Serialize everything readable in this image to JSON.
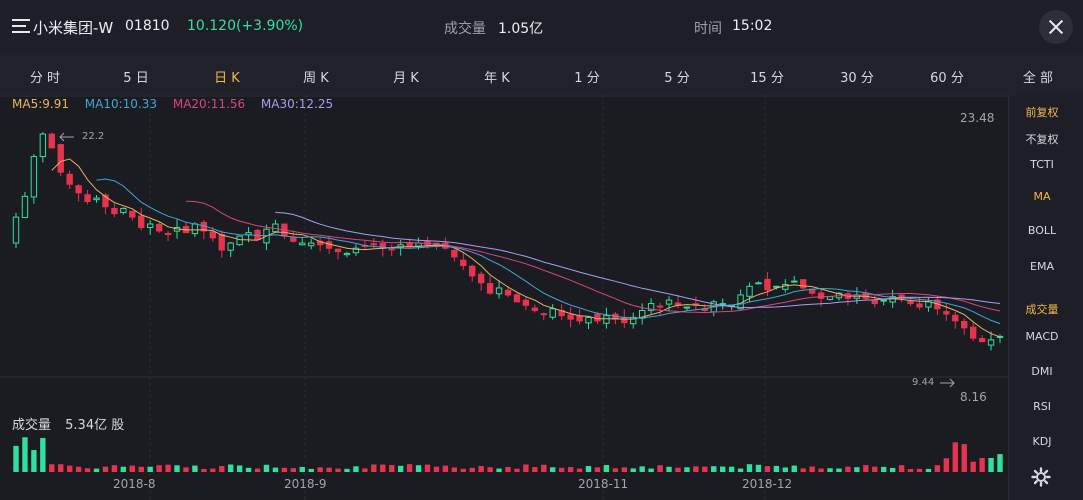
{
  "header": {
    "stock_name": "小米集团-W",
    "stock_code": "01810",
    "price_change": "10.120(+3.90%)",
    "volume_label": "成交量",
    "volume_value": "1.05亿",
    "time_label": "时间",
    "time_value": "15:02"
  },
  "tabs": [
    {
      "label": "分 时"
    },
    {
      "label": "5 日"
    },
    {
      "label": "日 K",
      "active": true
    },
    {
      "label": "周 K"
    },
    {
      "label": "月 K"
    },
    {
      "label": "年 K"
    },
    {
      "label": "1 分"
    },
    {
      "label": "5 分"
    },
    {
      "label": "15 分"
    },
    {
      "label": "30 分"
    },
    {
      "label": "60 分"
    },
    {
      "label": "全 部"
    }
  ],
  "ma_legend": [
    {
      "text": "MA5:9.91",
      "color": "#e6b462"
    },
    {
      "text": "MA10:10.33",
      "color": "#3fa6d8"
    },
    {
      "text": "MA20:11.56",
      "color": "#d9467a"
    },
    {
      "text": "MA30:12.25",
      "color": "#a89cf0"
    }
  ],
  "price_axis": {
    "high_label": "23.48",
    "low_label": "8.16",
    "max_marker": "22.2",
    "min_marker": "9.44"
  },
  "volume_panel": {
    "label": "成交量",
    "value": "5.34亿 股"
  },
  "date_labels": [
    "2018-8",
    "2018-9",
    "2018-11",
    "2018-12"
  ],
  "sidebar": {
    "items": [
      {
        "label": "前复权",
        "active": true
      },
      {
        "label": "不复权"
      },
      {
        "label": "TCTI"
      },
      {
        "label": "MA",
        "active": true
      },
      {
        "label": "BOLL"
      },
      {
        "label": "EMA"
      },
      {
        "label": "成交量",
        "active": true
      },
      {
        "label": "MACD"
      },
      {
        "label": "DMI"
      },
      {
        "label": "RSI"
      },
      {
        "label": "KDJ"
      }
    ]
  },
  "colors": {
    "up": "#2fe0a0",
    "down": "#e8334f",
    "accent": "#f2b84b",
    "ma5": "#e6b462",
    "ma10": "#3fa6d8",
    "ma20": "#d9467a",
    "ma30": "#a89cf0"
  },
  "icons": {
    "menu": "menu-icon",
    "close": "close-icon",
    "settings": "gear-icon"
  },
  "chart_data": {
    "type": "candlestick",
    "x_range": [
      "2018-07",
      "2018-12"
    ],
    "y_range": [
      8.16,
      23.48
    ],
    "closes": [
      17.0,
      18.2,
      20.5,
      21.8,
      21.0,
      19.6,
      18.9,
      18.4,
      17.9,
      18.1,
      17.6,
      17.2,
      17.5,
      17.0,
      16.4,
      16.6,
      16.2,
      16.0,
      16.4,
      16.1,
      16.6,
      16.2,
      15.8,
      15.1,
      15.5,
      15.9,
      16.1,
      15.7,
      16.3,
      16.6,
      15.9,
      15.6,
      15.5,
      15.5,
      15.4,
      15.2,
      15.0,
      14.9,
      15.2,
      15.3,
      15.4,
      15.2,
      15.1,
      15.4,
      15.3,
      15.5,
      15.4,
      15.3,
      15.2,
      14.7,
      14.2,
      13.6,
      13.2,
      12.6,
      12.9,
      12.5,
      12.1,
      11.9,
      11.6,
      11.4,
      11.7,
      11.3,
      11.1,
      11.0,
      11.2,
      11.0,
      11.3,
      11.1,
      10.9,
      11.2,
      11.6,
      12.0,
      11.8,
      12.2,
      11.9,
      11.8,
      11.9,
      11.6,
      12.1,
      12.0,
      11.9,
      12.5,
      13.0,
      13.2,
      12.8,
      13.0,
      13.1,
      13.3,
      12.9,
      12.6,
      12.3,
      12.4,
      12.6,
      12.3,
      12.5,
      12.3,
      12.0,
      12.2,
      12.4,
      12.3,
      12.0,
      11.8,
      12.1,
      11.7,
      11.4,
      11.0,
      10.6,
      10.0,
      9.8,
      9.9,
      10.1
    ],
    "ma": [
      {
        "name": "MA5",
        "last": 9.91
      },
      {
        "name": "MA10",
        "last": 10.33
      },
      {
        "name": "MA20",
        "last": 11.56
      },
      {
        "name": "MA30",
        "last": 12.25
      }
    ]
  }
}
